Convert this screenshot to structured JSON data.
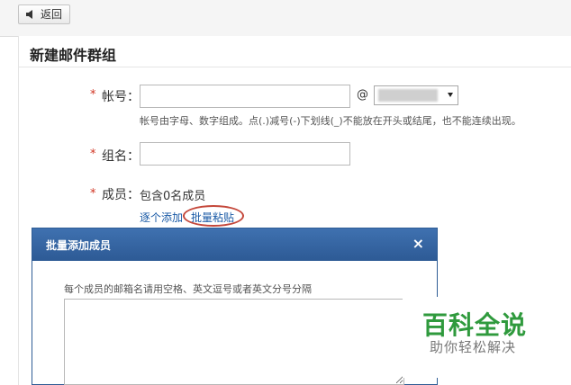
{
  "toolbar": {
    "back_label": "返回"
  },
  "page": {
    "title": "新建邮件群组"
  },
  "form": {
    "account": {
      "required_mark": "*",
      "label": "帐号：",
      "value": "",
      "at": "@",
      "domain_value": "",
      "hint": "帐号由字母、数字组成。点(.)减号(-)下划线(_)不能放在开头或结尾，也不能连续出现。"
    },
    "group_name": {
      "required_mark": "*",
      "label": "组名：",
      "value": ""
    },
    "members": {
      "required_mark": "*",
      "label": "成员：",
      "summary": "包含0名成员",
      "add_one_label": "逐个添加",
      "batch_paste_label": "批量粘贴"
    }
  },
  "dialog": {
    "title": "批量添加成员",
    "close": "×",
    "tip": "每个成员的邮箱名请用空格、英文逗号或者英文分号分隔",
    "textarea_value": ""
  },
  "watermark": {
    "title": "百科全说",
    "subtitle": "助你轻松解决"
  },
  "colors": {
    "required": "#d0321f",
    "link": "#1a5aa6",
    "dialog_header": "#2f5d95",
    "highlight_circle": "#c4473a",
    "watermark": "#2f9a3d"
  }
}
